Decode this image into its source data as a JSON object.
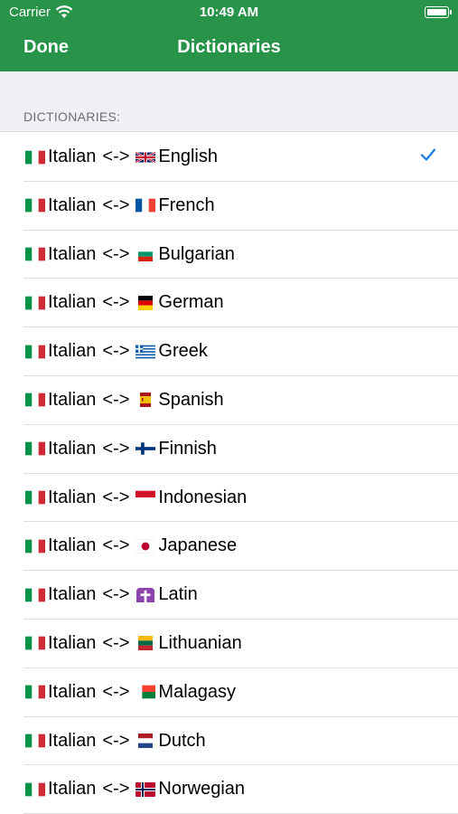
{
  "status_bar": {
    "carrier": "Carrier",
    "time": "10:49 AM"
  },
  "nav": {
    "done_label": "Done",
    "title": "Dictionaries"
  },
  "section_header": "DICTIONARIES:",
  "accent_color": "#27944a",
  "check_color": "#1a7be0",
  "rows": [
    {
      "from": "Italian",
      "separator": "<->",
      "to": "English",
      "from_flag": "flag-italy-icon",
      "to_flag": "flag-uk-icon",
      "selected": true
    },
    {
      "from": "Italian",
      "separator": "<->",
      "to": "French",
      "from_flag": "flag-italy-icon",
      "to_flag": "flag-france-icon",
      "selected": false
    },
    {
      "from": "Italian",
      "separator": "<->",
      "to": "Bulgarian",
      "from_flag": "flag-italy-icon",
      "to_flag": "flag-bulgaria-icon",
      "selected": false
    },
    {
      "from": "Italian",
      "separator": "<->",
      "to": "German",
      "from_flag": "flag-italy-icon",
      "to_flag": "flag-germany-icon",
      "selected": false
    },
    {
      "from": "Italian",
      "separator": "<->",
      "to": "Greek",
      "from_flag": "flag-italy-icon",
      "to_flag": "flag-greece-icon",
      "selected": false
    },
    {
      "from": "Italian",
      "separator": "<->",
      "to": "Spanish",
      "from_flag": "flag-italy-icon",
      "to_flag": "flag-spain-icon",
      "selected": false
    },
    {
      "from": "Italian",
      "separator": "<->",
      "to": "Finnish",
      "from_flag": "flag-italy-icon",
      "to_flag": "flag-finland-icon",
      "selected": false
    },
    {
      "from": "Italian",
      "separator": "<->",
      "to": "Indonesian",
      "from_flag": "flag-italy-icon",
      "to_flag": "flag-indonesia-icon",
      "selected": false
    },
    {
      "from": "Italian",
      "separator": "<->",
      "to": "Japanese",
      "from_flag": "flag-italy-icon",
      "to_flag": "flag-japan-icon",
      "selected": false
    },
    {
      "from": "Italian",
      "separator": "<->",
      "to": "Latin",
      "from_flag": "flag-italy-icon",
      "to_flag": "latin-cross-icon",
      "selected": false
    },
    {
      "from": "Italian",
      "separator": "<->",
      "to": "Lithuanian",
      "from_flag": "flag-italy-icon",
      "to_flag": "flag-lithuania-icon",
      "selected": false
    },
    {
      "from": "Italian",
      "separator": "<->",
      "to": "Malagasy",
      "from_flag": "flag-italy-icon",
      "to_flag": "flag-madagascar-icon",
      "selected": false
    },
    {
      "from": "Italian",
      "separator": "<->",
      "to": "Dutch",
      "from_flag": "flag-italy-icon",
      "to_flag": "flag-netherlands-icon",
      "selected": false
    },
    {
      "from": "Italian",
      "separator": "<->",
      "to": "Norwegian",
      "from_flag": "flag-italy-icon",
      "to_flag": "flag-norway-icon",
      "selected": false
    }
  ]
}
